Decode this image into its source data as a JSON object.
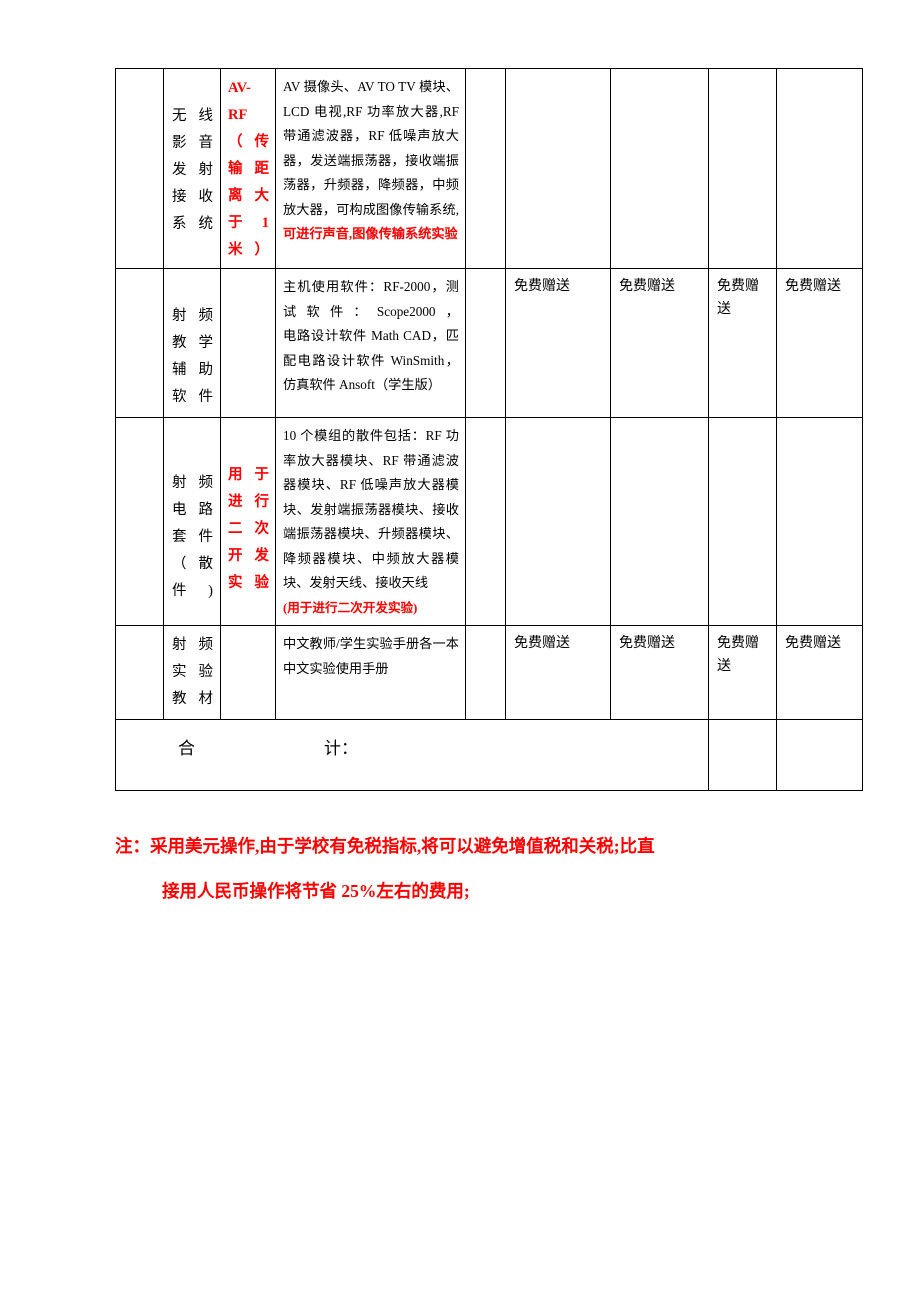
{
  "document": {
    "type": "quotation-table"
  },
  "table": {
    "rows": [
      {
        "blank": "",
        "name": "无线影音发射接收系统",
        "spec": "AV-RF（传输距离大于 1 米）",
        "desc_main": "AV 摄像头、AV TO TV 模块、LCD 电视,RF 功率放大器,RF 带通滤波器，RF 低噪声放大器，发送端振荡器，接收端振荡器，升频器，降频器，中频放大器，可构成图像传输系统,",
        "desc_red": "可进行声音,图像传输系统实验",
        "q1": "",
        "q2": "",
        "q3": "",
        "q4": "",
        "q5": ""
      },
      {
        "blank": "",
        "name": "射频教学辅助软件",
        "spec": "",
        "desc_lines": [
          "主机使用软件：RF-2000，测试软件：Scope2000，",
          "电路设计软件 Math CAD，匹配电路设计软件 WinSmith，",
          "仿真软件 Ansoft（学生版）"
        ],
        "q1": "",
        "q2": "免费赠送",
        "q3": "免费赠送",
        "q4": "免费赠送",
        "q5": "免费赠送"
      },
      {
        "blank": "",
        "name": "射频电路套件（散件)",
        "spec": "用于进行二次开发实验",
        "desc_main": "10 个模组的散件包括：RF 功率放大器模块、RF 带通滤波器模块、RF 低噪声放大器模块、发射端振荡器模块、接收端振荡器模块、升频器模块、降频器模块、中频放大器模块、发射天线、接收天线",
        "desc_red": "(用于进行二次开发实验)",
        "q1": "",
        "q2": "",
        "q3": "",
        "q4": "",
        "q5": ""
      },
      {
        "blank": "",
        "name": "射频实验教材",
        "spec": "",
        "desc_lines": [
          "中文教师/学生实验手册各一本",
          "中文实验使用手册"
        ],
        "q1": "",
        "q2": "免费赠送",
        "q3": "免费赠送",
        "q4": "免费赠送",
        "q5": "免费赠送"
      }
    ],
    "total_row": {
      "label_he": "合",
      "label_ji": "计：",
      "col_a": "",
      "col_b": ""
    }
  },
  "note": {
    "line1": "注：采用美元操作,由于学校有免税指标,将可以避免增值税和关税;比直",
    "line2_pre": "接用人民币操作将节省 ",
    "line2_pct": "25%",
    "line2_post": "左右的费用;"
  },
  "colors": {
    "accent_red": "#ff0000",
    "text": "#000000",
    "border": "#000000"
  }
}
